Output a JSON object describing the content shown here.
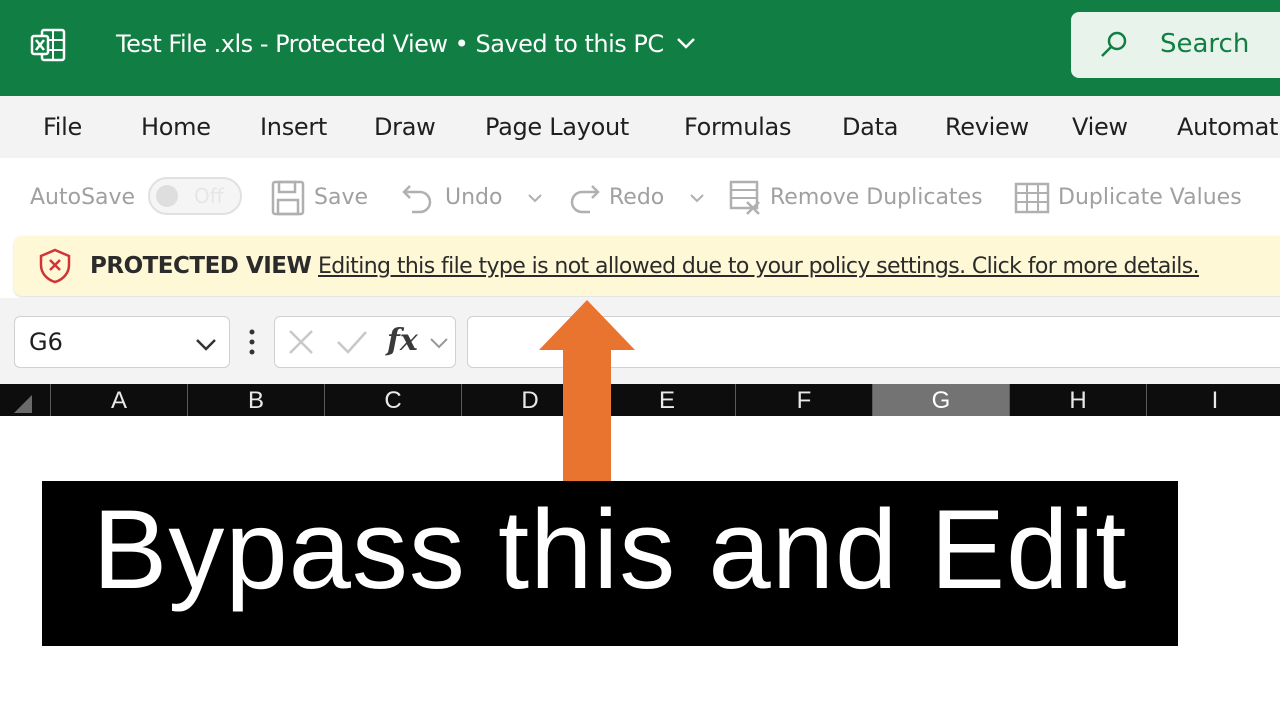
{
  "window": {
    "title": "Test File .xls  -  Protected View • Saved to this PC",
    "search_label": "Search",
    "accent_color": "#117e43"
  },
  "ribbon_tabs": [
    "File",
    "Home",
    "Insert",
    "Draw",
    "Page Layout",
    "Formulas",
    "Data",
    "Review",
    "View",
    "Automat"
  ],
  "toolbar": {
    "autosave_label": "AutoSave",
    "autosave_state": "Off",
    "save_label": "Save",
    "undo_label": "Undo",
    "redo_label": "Redo",
    "remove_duplicates_label": "Remove Duplicates",
    "duplicate_values_label": "Duplicate Values"
  },
  "protected_view": {
    "title": "PROTECTED VIEW",
    "message": "Editing this file type is not allowed due to your policy settings. Click for more details.",
    "background": "#fff8d6",
    "icon_color": "#d13438"
  },
  "formula_bar": {
    "cell_reference": "G6",
    "fx_label": "fx",
    "value": ""
  },
  "columns": [
    "A",
    "B",
    "C",
    "D",
    "E",
    "F",
    "G",
    "H",
    "I"
  ],
  "selected_column": "G",
  "overlay": {
    "caption": "Bypass this and Edit",
    "arrow_color": "#e87430"
  }
}
